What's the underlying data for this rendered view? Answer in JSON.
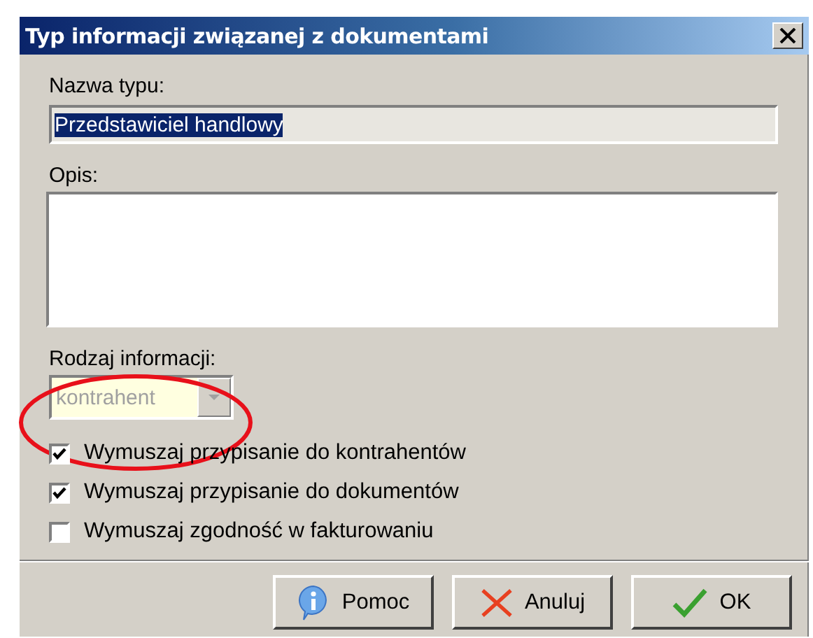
{
  "window": {
    "title": "Typ informacji związanej z dokumentami"
  },
  "name_field": {
    "label": "Nazwa typu:",
    "value": "Przedstawiciel handlowy",
    "selected": true
  },
  "description_field": {
    "label": "Opis:"
  },
  "info_type": {
    "label": "Rodzaj informacji:",
    "value": "kontrahent",
    "disabled": true
  },
  "checkboxes": [
    {
      "label": "Wymuszaj przypisanie do kontrahentów",
      "checked": true
    },
    {
      "label": "Wymuszaj przypisanie do dokumentów",
      "checked": true
    },
    {
      "label": "Wymuszaj zgodność w fakturowaniu",
      "checked": false
    }
  ],
  "buttons": [
    {
      "label": "Pomoc",
      "kind": "help"
    },
    {
      "label": "Anuluj",
      "kind": "cancel"
    },
    {
      "label": "OK",
      "kind": "ok"
    }
  ],
  "annotation": {
    "kind": "ellipse"
  }
}
